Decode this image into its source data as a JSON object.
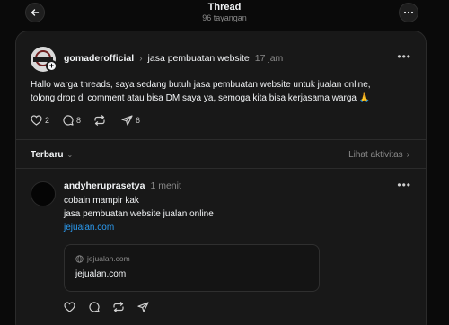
{
  "header": {
    "title": "Thread",
    "views": "96 tayangan"
  },
  "post": {
    "username": "gomaderofficial",
    "topic": "jasa pembuatan website",
    "time": "17 jam",
    "text_line1": "Hallo warga threads, saya sedang butuh jasa pembuatan website untuk jualan online,",
    "text_line2": "tolong drop di comment atau bisa DM saya ya, semoga kita bisa kerjasama warga 🙏",
    "likes": "2",
    "comments": "8",
    "reposts": "",
    "shares": "6"
  },
  "sort": {
    "label": "Terbaru",
    "activity": "Lihat aktivitas"
  },
  "reply": {
    "username": "andyheruprasetya",
    "time": "1 menit",
    "line1": "cobain mampir kak",
    "line2": "jasa pembuatan website jualan online",
    "link": "jejualan.com",
    "preview_domain": "jejualan.com",
    "preview_title": "jejualan.com"
  },
  "colors": {
    "background": "#0a0a0a",
    "card": "#181818",
    "link": "#2b9bf1",
    "muted": "#8a8a8a"
  },
  "icons": [
    "back-arrow-icon",
    "more-icon",
    "heart-icon",
    "comment-icon",
    "repost-icon",
    "share-icon",
    "globe-icon",
    "chevron-down-icon",
    "chevron-right-icon"
  ]
}
